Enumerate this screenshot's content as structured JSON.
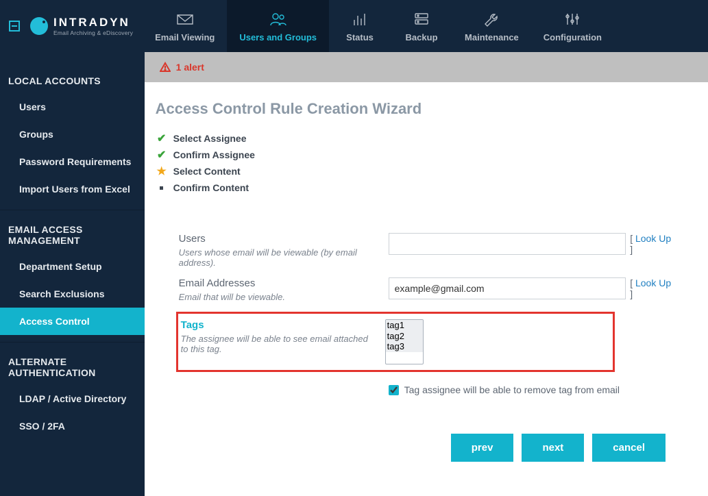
{
  "brand": {
    "name": "INTRADYN",
    "tagline": "Email Archiving & eDiscovery"
  },
  "nav": [
    {
      "label": "Email Viewing",
      "icon": "envelope",
      "active": false
    },
    {
      "label": "Users and Groups",
      "icon": "users",
      "active": true
    },
    {
      "label": "Status",
      "icon": "bars",
      "active": false
    },
    {
      "label": "Backup",
      "icon": "server",
      "active": false
    },
    {
      "label": "Maintenance",
      "icon": "wrench",
      "active": false
    },
    {
      "label": "Configuration",
      "icon": "sliders",
      "active": false
    }
  ],
  "sidebar": {
    "sections": [
      {
        "title": "LOCAL ACCOUNTS",
        "items": [
          {
            "label": "Users"
          },
          {
            "label": "Groups"
          },
          {
            "label": "Password Requirements"
          },
          {
            "label": "Import Users from Excel"
          }
        ]
      },
      {
        "title": "EMAIL ACCESS MANAGEMENT",
        "items": [
          {
            "label": "Department Setup"
          },
          {
            "label": "Search Exclusions"
          },
          {
            "label": "Access Control",
            "active": true
          }
        ]
      },
      {
        "title": "ALTERNATE AUTHENTICATION",
        "items": [
          {
            "label": "LDAP / Active Directory"
          },
          {
            "label": "SSO / 2FA"
          }
        ]
      }
    ]
  },
  "alert": {
    "text": "1 alert"
  },
  "page": {
    "title": "Access Control Rule Creation Wizard",
    "steps": [
      {
        "label": "Select Assignee",
        "state": "done"
      },
      {
        "label": "Confirm Assignee",
        "state": "done"
      },
      {
        "label": "Select Content",
        "state": "current"
      },
      {
        "label": "Confirm Content",
        "state": "pending"
      }
    ]
  },
  "form": {
    "users": {
      "label": "Users",
      "help": "Users whose email will be viewable (by email address).",
      "value": "",
      "lookup": "Look Up"
    },
    "emails": {
      "label": "Email Addresses",
      "help": "Email that will be viewable.",
      "value": "example@gmail.com",
      "lookup": "Look Up"
    },
    "tags": {
      "label": "Tags",
      "help": "The assignee will be able to see email attached to this tag.",
      "options": [
        "tag1",
        "tag2",
        "tag3"
      ]
    },
    "removeTag": {
      "label": "Tag assignee will be able to remove tag from email",
      "checked": true
    }
  },
  "buttons": {
    "prev": "prev",
    "next": "next",
    "cancel": "cancel"
  },
  "lookupBrackets": {
    "open": "[ ",
    "close": " ]"
  }
}
